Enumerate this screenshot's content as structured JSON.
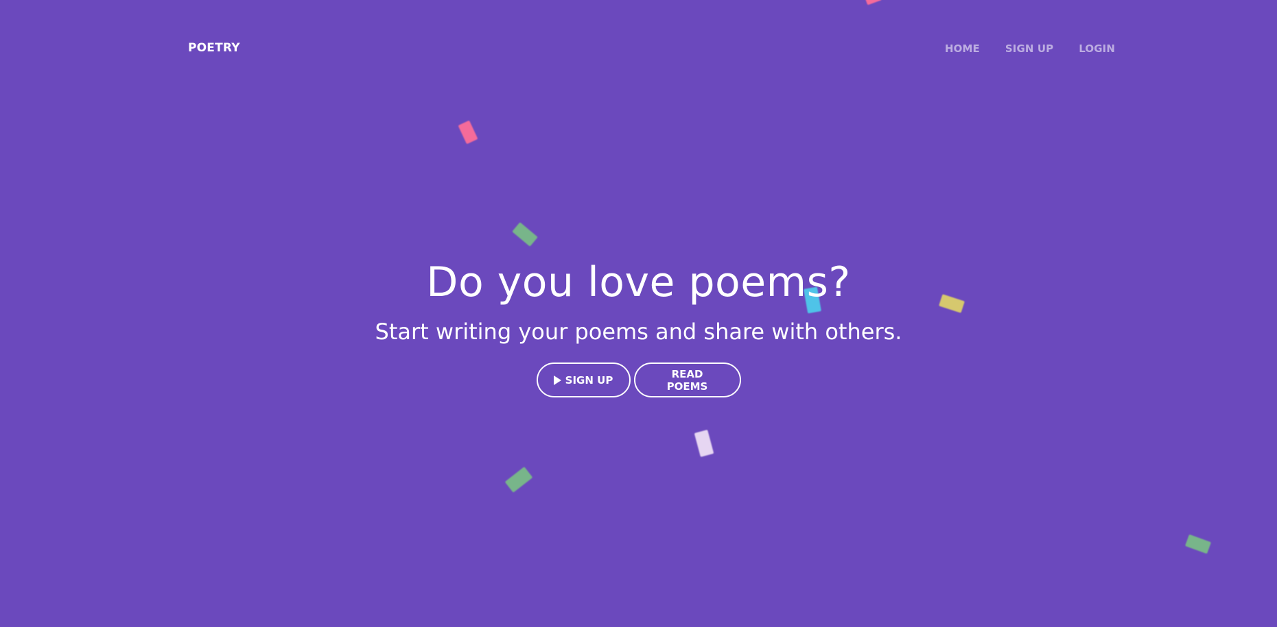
{
  "nav": {
    "brand": "POETRY",
    "links": [
      "HOME",
      "SIGN UP",
      "LOGIN"
    ]
  },
  "hero": {
    "title": "Do you love poems?",
    "subtitle": "Start writing your poems and share with others.",
    "buttons": {
      "signup": "SIGN UP",
      "read": "READ POEMS"
    }
  },
  "colors": {
    "background": "#6b49bd",
    "text": "#ffffff",
    "nav_link": "rgba(255,255,255,0.55)"
  },
  "confetti_colors": [
    "#f56b9a",
    "#78b58a",
    "#4fc3e8",
    "#d6c86e",
    "#e6d6f2"
  ]
}
